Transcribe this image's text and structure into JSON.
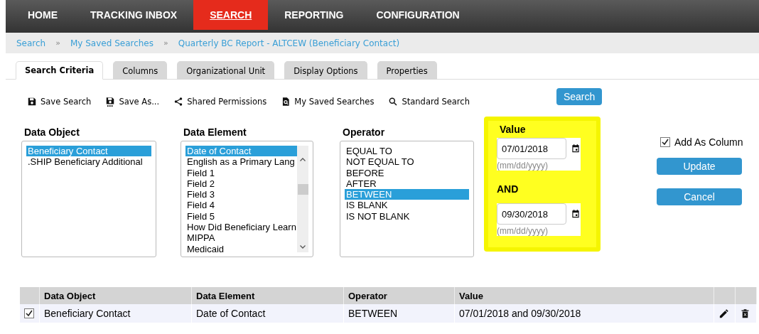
{
  "nav": [
    {
      "label": "HOME",
      "selected": false
    },
    {
      "label": "TRACKING INBOX",
      "selected": false
    },
    {
      "label": "SEARCH",
      "selected": true
    },
    {
      "label": "REPORTING",
      "selected": false
    },
    {
      "label": "CONFIGURATION",
      "selected": false
    }
  ],
  "breadcrumbs": [
    {
      "kind": "link",
      "label": "Search"
    },
    {
      "kind": "separator",
      "label": "»"
    },
    {
      "kind": "link",
      "label": "My Saved Searches"
    },
    {
      "kind": "separator",
      "label": "»"
    },
    {
      "kind": "link",
      "label": "Quarterly BC Report - ALTCEW (Beneficiary Contact)"
    }
  ],
  "tabs": [
    {
      "label": "Search Criteria",
      "selected": true
    },
    {
      "label": "Columns",
      "selected": false
    },
    {
      "label": "Organizational Unit",
      "selected": false
    },
    {
      "label": "Display Options",
      "selected": false
    },
    {
      "label": "Properties",
      "selected": false
    }
  ],
  "toolbar": [
    {
      "kind": "save",
      "label": "Save Search"
    },
    {
      "kind": "save_as",
      "label": "Save As..."
    },
    {
      "kind": "share",
      "label": "Shared Permissions"
    },
    {
      "kind": "saved",
      "label": "My Saved Searches"
    },
    {
      "kind": "search",
      "label": "Standard Search"
    }
  ],
  "search_button": "Search",
  "lists": [
    {
      "label": "Data Object",
      "scrollbar": false,
      "items": [
        {
          "label": "Beneficiary Contact",
          "selected": true
        },
        {
          "label": ".SHIP Beneficiary Additional",
          "selected": false
        }
      ]
    },
    {
      "label": "Data Element",
      "scrollbar": true,
      "items": [
        {
          "label": "Date of Contact",
          "selected": true
        },
        {
          "label": "English as a Primary Lang",
          "selected": false
        },
        {
          "label": "Field 1",
          "selected": false
        },
        {
          "label": "Field 2",
          "selected": false
        },
        {
          "label": "Field 3",
          "selected": false
        },
        {
          "label": "Field 4",
          "selected": false
        },
        {
          "label": "Field 5",
          "selected": false
        },
        {
          "label": "How Did Beneficiary Learn",
          "selected": false
        },
        {
          "label": "MIPPA",
          "selected": false
        },
        {
          "label": "Medicaid",
          "selected": false
        }
      ]
    },
    {
      "label": "Operator",
      "scrollbar": false,
      "items": [
        {
          "label": "EQUAL TO",
          "selected": false
        },
        {
          "label": "NOT EQUAL TO",
          "selected": false
        },
        {
          "label": "BEFORE",
          "selected": false
        },
        {
          "label": "AFTER",
          "selected": false
        },
        {
          "label": "BETWEEN",
          "selected": true
        },
        {
          "label": "IS BLANK",
          "selected": false
        },
        {
          "label": "IS NOT BLANK",
          "selected": false
        }
      ]
    }
  ],
  "value": {
    "label": "Value",
    "highlighted": true,
    "from": {
      "value": "07/01/2018",
      "hint": "(mm/dd/yyyy)"
    },
    "and_label": "AND",
    "to": {
      "value": "09/30/2018",
      "hint": "(mm/dd/yyyy)"
    }
  },
  "add_as_column": {
    "label": "Add As Column",
    "checked": true
  },
  "buttons": [
    "Update",
    "Cancel"
  ],
  "table": {
    "columns": [
      "Data Object",
      "Data Element",
      "Operator",
      "Value"
    ],
    "rows": [
      {
        "checked": true,
        "cells": [
          "Beneficiary Contact",
          "Date of Contact",
          "BETWEEN",
          "07/01/2018 and 09/30/2018"
        ]
      }
    ]
  }
}
